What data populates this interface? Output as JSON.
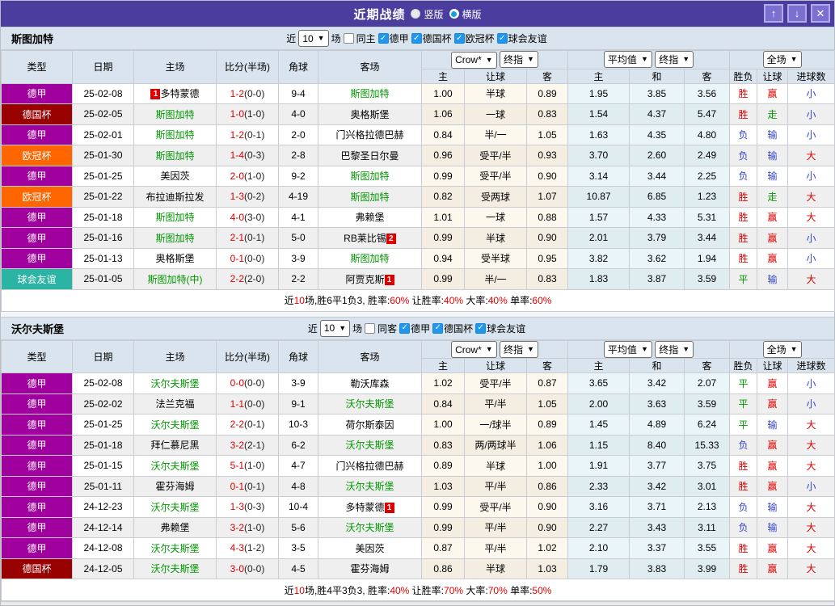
{
  "titlebar": {
    "title": "近期战绩",
    "radio_vertical_label": "竖版",
    "radio_horizontal_label": "横版",
    "up_button": "↑",
    "down_button": "↓",
    "close_button": "✕"
  },
  "filter": {
    "prefix": "近",
    "count": "10",
    "suffix": "场"
  },
  "columns": {
    "type": "类型",
    "date": "日期",
    "home": "主场",
    "score": "比分(半场)",
    "corner": "角球",
    "away": "客场",
    "provider1": "Crow*",
    "stage1": "终指",
    "provider2": "平均值",
    "stage2": "终指",
    "scope": "全场",
    "sub": [
      "主",
      "让球",
      "客",
      "主",
      "和",
      "客",
      "胜负",
      "让球",
      "进球数"
    ]
  },
  "colors": {
    "header_purple": "#4a3d9e",
    "accent_blue": "#1f97ef",
    "team_green": "#009900",
    "score_red": "#dd0000",
    "league": {
      "德甲": "#a0009e",
      "德国杯": "#990000",
      "欧冠杯": "#ff6600",
      "球会友谊": "#2bb3a3"
    },
    "result": {
      "胜": "#dd0000",
      "赢": "#dd0000",
      "大": "#dd0000",
      "平": "#009900",
      "走": "#009900",
      "负": "#3344cc",
      "输": "#3344cc",
      "小": "#3344cc"
    }
  },
  "sections": [
    {
      "team": "斯图加特",
      "same_label": "同主",
      "leagues": [
        "德甲",
        "德国杯",
        "欧冠杯",
        "球会友谊"
      ],
      "rows": [
        {
          "lg": "德甲",
          "date": "25-02-08",
          "home": {
            "n": "多特蒙德",
            "g": false,
            "b": "1",
            "bp": "before"
          },
          "score": "1-2",
          "half": "(0-0)",
          "cor": "9-4",
          "away": {
            "n": "斯图加特",
            "g": true
          },
          "o": [
            "1.00",
            "半球",
            "0.89"
          ],
          "a": [
            "1.95",
            "3.85",
            "3.56"
          ],
          "r": [
            "胜",
            "赢",
            "小"
          ]
        },
        {
          "lg": "德国杯",
          "date": "25-02-05",
          "home": {
            "n": "斯图加特",
            "g": true
          },
          "score": "1-0",
          "half": "(1-0)",
          "cor": "4-0",
          "away": {
            "n": "奥格斯堡",
            "g": false
          },
          "o": [
            "1.06",
            "一球",
            "0.83"
          ],
          "a": [
            "1.54",
            "4.37",
            "5.47"
          ],
          "r": [
            "胜",
            "走",
            "小"
          ]
        },
        {
          "lg": "德甲",
          "date": "25-02-01",
          "home": {
            "n": "斯图加特",
            "g": true
          },
          "score": "1-2",
          "half": "(0-1)",
          "cor": "2-0",
          "away": {
            "n": "门兴格拉德巴赫",
            "g": false
          },
          "o": [
            "0.84",
            "半/一",
            "1.05"
          ],
          "a": [
            "1.63",
            "4.35",
            "4.80"
          ],
          "r": [
            "负",
            "输",
            "小"
          ]
        },
        {
          "lg": "欧冠杯",
          "date": "25-01-30",
          "home": {
            "n": "斯图加特",
            "g": true
          },
          "score": "1-4",
          "half": "(0-3)",
          "cor": "2-8",
          "away": {
            "n": "巴黎圣日尔曼",
            "g": false
          },
          "o": [
            "0.96",
            "受平/半",
            "0.93"
          ],
          "a": [
            "3.70",
            "2.60",
            "2.49"
          ],
          "r": [
            "负",
            "输",
            "大"
          ]
        },
        {
          "lg": "德甲",
          "date": "25-01-25",
          "home": {
            "n": "美因茨",
            "g": false
          },
          "score": "2-0",
          "half": "(1-0)",
          "cor": "9-2",
          "away": {
            "n": "斯图加特",
            "g": true
          },
          "o": [
            "0.99",
            "受平/半",
            "0.90"
          ],
          "a": [
            "3.14",
            "3.44",
            "2.25"
          ],
          "r": [
            "负",
            "输",
            "小"
          ]
        },
        {
          "lg": "欧冠杯",
          "date": "25-01-22",
          "home": {
            "n": "布拉迪斯拉发",
            "g": false
          },
          "score": "1-3",
          "half": "(0-2)",
          "cor": "4-19",
          "away": {
            "n": "斯图加特",
            "g": true
          },
          "o": [
            "0.82",
            "受两球",
            "1.07"
          ],
          "a": [
            "10.87",
            "6.85",
            "1.23"
          ],
          "r": [
            "胜",
            "走",
            "大"
          ]
        },
        {
          "lg": "德甲",
          "date": "25-01-18",
          "home": {
            "n": "斯图加特",
            "g": true
          },
          "score": "4-0",
          "half": "(3-0)",
          "cor": "4-1",
          "away": {
            "n": "弗赖堡",
            "g": false
          },
          "o": [
            "1.01",
            "一球",
            "0.88"
          ],
          "a": [
            "1.57",
            "4.33",
            "5.31"
          ],
          "r": [
            "胜",
            "赢",
            "大"
          ]
        },
        {
          "lg": "德甲",
          "date": "25-01-16",
          "home": {
            "n": "斯图加特",
            "g": true
          },
          "score": "2-1",
          "half": "(0-1)",
          "cor": "5-0",
          "away": {
            "n": "RB莱比锡",
            "g": false,
            "b": "2",
            "bp": "after"
          },
          "o": [
            "0.99",
            "半球",
            "0.90"
          ],
          "a": [
            "2.01",
            "3.79",
            "3.44"
          ],
          "r": [
            "胜",
            "赢",
            "小"
          ]
        },
        {
          "lg": "德甲",
          "date": "25-01-13",
          "home": {
            "n": "奥格斯堡",
            "g": false
          },
          "score": "0-1",
          "half": "(0-0)",
          "cor": "3-9",
          "away": {
            "n": "斯图加特",
            "g": true
          },
          "o": [
            "0.94",
            "受半球",
            "0.95"
          ],
          "a": [
            "3.82",
            "3.62",
            "1.94"
          ],
          "r": [
            "胜",
            "赢",
            "小"
          ]
        },
        {
          "lg": "球会友谊",
          "date": "25-01-05",
          "home": {
            "n": "斯图加特(中)",
            "g": true
          },
          "score": "2-2",
          "half": "(2-0)",
          "cor": "2-2",
          "away": {
            "n": "阿贾克斯",
            "g": false,
            "b": "1",
            "bp": "after"
          },
          "o": [
            "0.99",
            "半/一",
            "0.83"
          ],
          "a": [
            "1.83",
            "3.87",
            "3.59"
          ],
          "r": [
            "平",
            "输",
            "大"
          ]
        }
      ],
      "summary": [
        {
          "t": "近",
          "red": false
        },
        {
          "t": "10",
          "red": true
        },
        {
          "t": "场,胜6平1负3, 胜率:",
          "red": false
        },
        {
          "t": "60%",
          "red": true
        },
        {
          "t": " 让胜率:",
          "red": false
        },
        {
          "t": "40%",
          "red": true
        },
        {
          "t": " 大率:",
          "red": false
        },
        {
          "t": "40%",
          "red": true
        },
        {
          "t": " 单率:",
          "red": false
        },
        {
          "t": "60%",
          "red": true
        }
      ]
    },
    {
      "team": "沃尔夫斯堡",
      "same_label": "同客",
      "leagues": [
        "德甲",
        "德国杯",
        "球会友谊"
      ],
      "rows": [
        {
          "lg": "德甲",
          "date": "25-02-08",
          "home": {
            "n": "沃尔夫斯堡",
            "g": true
          },
          "score": "0-0",
          "half": "(0-0)",
          "cor": "3-9",
          "away": {
            "n": "勒沃库森",
            "g": false
          },
          "o": [
            "1.02",
            "受平/半",
            "0.87"
          ],
          "a": [
            "3.65",
            "3.42",
            "2.07"
          ],
          "r": [
            "平",
            "赢",
            "小"
          ]
        },
        {
          "lg": "德甲",
          "date": "25-02-02",
          "home": {
            "n": "法兰克福",
            "g": false
          },
          "score": "1-1",
          "half": "(0-0)",
          "cor": "9-1",
          "away": {
            "n": "沃尔夫斯堡",
            "g": true
          },
          "o": [
            "0.84",
            "平/半",
            "1.05"
          ],
          "a": [
            "2.00",
            "3.63",
            "3.59"
          ],
          "r": [
            "平",
            "赢",
            "小"
          ]
        },
        {
          "lg": "德甲",
          "date": "25-01-25",
          "home": {
            "n": "沃尔夫斯堡",
            "g": true
          },
          "score": "2-2",
          "half": "(0-1)",
          "cor": "10-3",
          "away": {
            "n": "荷尔斯泰因",
            "g": false
          },
          "o": [
            "1.00",
            "一/球半",
            "0.89"
          ],
          "a": [
            "1.45",
            "4.89",
            "6.24"
          ],
          "r": [
            "平",
            "输",
            "大"
          ]
        },
        {
          "lg": "德甲",
          "date": "25-01-18",
          "home": {
            "n": "拜仁慕尼黑",
            "g": false
          },
          "score": "3-2",
          "half": "(2-1)",
          "cor": "6-2",
          "away": {
            "n": "沃尔夫斯堡",
            "g": true
          },
          "o": [
            "0.83",
            "两/两球半",
            "1.06"
          ],
          "a": [
            "1.15",
            "8.40",
            "15.33"
          ],
          "r": [
            "负",
            "赢",
            "大"
          ]
        },
        {
          "lg": "德甲",
          "date": "25-01-15",
          "home": {
            "n": "沃尔夫斯堡",
            "g": true
          },
          "score": "5-1",
          "half": "(1-0)",
          "cor": "4-7",
          "away": {
            "n": "门兴格拉德巴赫",
            "g": false
          },
          "o": [
            "0.89",
            "半球",
            "1.00"
          ],
          "a": [
            "1.91",
            "3.77",
            "3.75"
          ],
          "r": [
            "胜",
            "赢",
            "大"
          ]
        },
        {
          "lg": "德甲",
          "date": "25-01-11",
          "home": {
            "n": "霍芬海姆",
            "g": false
          },
          "score": "0-1",
          "half": "(0-1)",
          "cor": "4-8",
          "away": {
            "n": "沃尔夫斯堡",
            "g": true
          },
          "o": [
            "1.03",
            "平/半",
            "0.86"
          ],
          "a": [
            "2.33",
            "3.42",
            "3.01"
          ],
          "r": [
            "胜",
            "赢",
            "小"
          ]
        },
        {
          "lg": "德甲",
          "date": "24-12-23",
          "home": {
            "n": "沃尔夫斯堡",
            "g": true
          },
          "score": "1-3",
          "half": "(0-3)",
          "cor": "10-4",
          "away": {
            "n": "多特蒙德",
            "g": false,
            "b": "1",
            "bp": "after"
          },
          "o": [
            "0.99",
            "受平/半",
            "0.90"
          ],
          "a": [
            "3.16",
            "3.71",
            "2.13"
          ],
          "r": [
            "负",
            "输",
            "大"
          ]
        },
        {
          "lg": "德甲",
          "date": "24-12-14",
          "home": {
            "n": "弗赖堡",
            "g": false
          },
          "score": "3-2",
          "half": "(1-0)",
          "cor": "5-6",
          "away": {
            "n": "沃尔夫斯堡",
            "g": true
          },
          "o": [
            "0.99",
            "平/半",
            "0.90"
          ],
          "a": [
            "2.27",
            "3.43",
            "3.11"
          ],
          "r": [
            "负",
            "输",
            "大"
          ]
        },
        {
          "lg": "德甲",
          "date": "24-12-08",
          "home": {
            "n": "沃尔夫斯堡",
            "g": true
          },
          "score": "4-3",
          "half": "(1-2)",
          "cor": "3-5",
          "away": {
            "n": "美因茨",
            "g": false
          },
          "o": [
            "0.87",
            "平/半",
            "1.02"
          ],
          "a": [
            "2.10",
            "3.37",
            "3.55"
          ],
          "r": [
            "胜",
            "赢",
            "大"
          ]
        },
        {
          "lg": "德国杯",
          "date": "24-12-05",
          "home": {
            "n": "沃尔夫斯堡",
            "g": true
          },
          "score": "3-0",
          "half": "(0-0)",
          "cor": "4-5",
          "away": {
            "n": "霍芬海姆",
            "g": false
          },
          "o": [
            "0.86",
            "半球",
            "1.03"
          ],
          "a": [
            "1.79",
            "3.83",
            "3.99"
          ],
          "r": [
            "胜",
            "赢",
            "大"
          ]
        }
      ],
      "summary": [
        {
          "t": "近",
          "red": false
        },
        {
          "t": "10",
          "red": true
        },
        {
          "t": "场,胜4平3负3, 胜率:",
          "red": false
        },
        {
          "t": "40%",
          "red": true
        },
        {
          "t": " 让胜率:",
          "red": false
        },
        {
          "t": "70%",
          "red": true
        },
        {
          "t": " 大率:",
          "red": false
        },
        {
          "t": "70%",
          "red": true
        },
        {
          "t": " 单率:",
          "red": false
        },
        {
          "t": "50%",
          "red": true
        }
      ]
    }
  ]
}
